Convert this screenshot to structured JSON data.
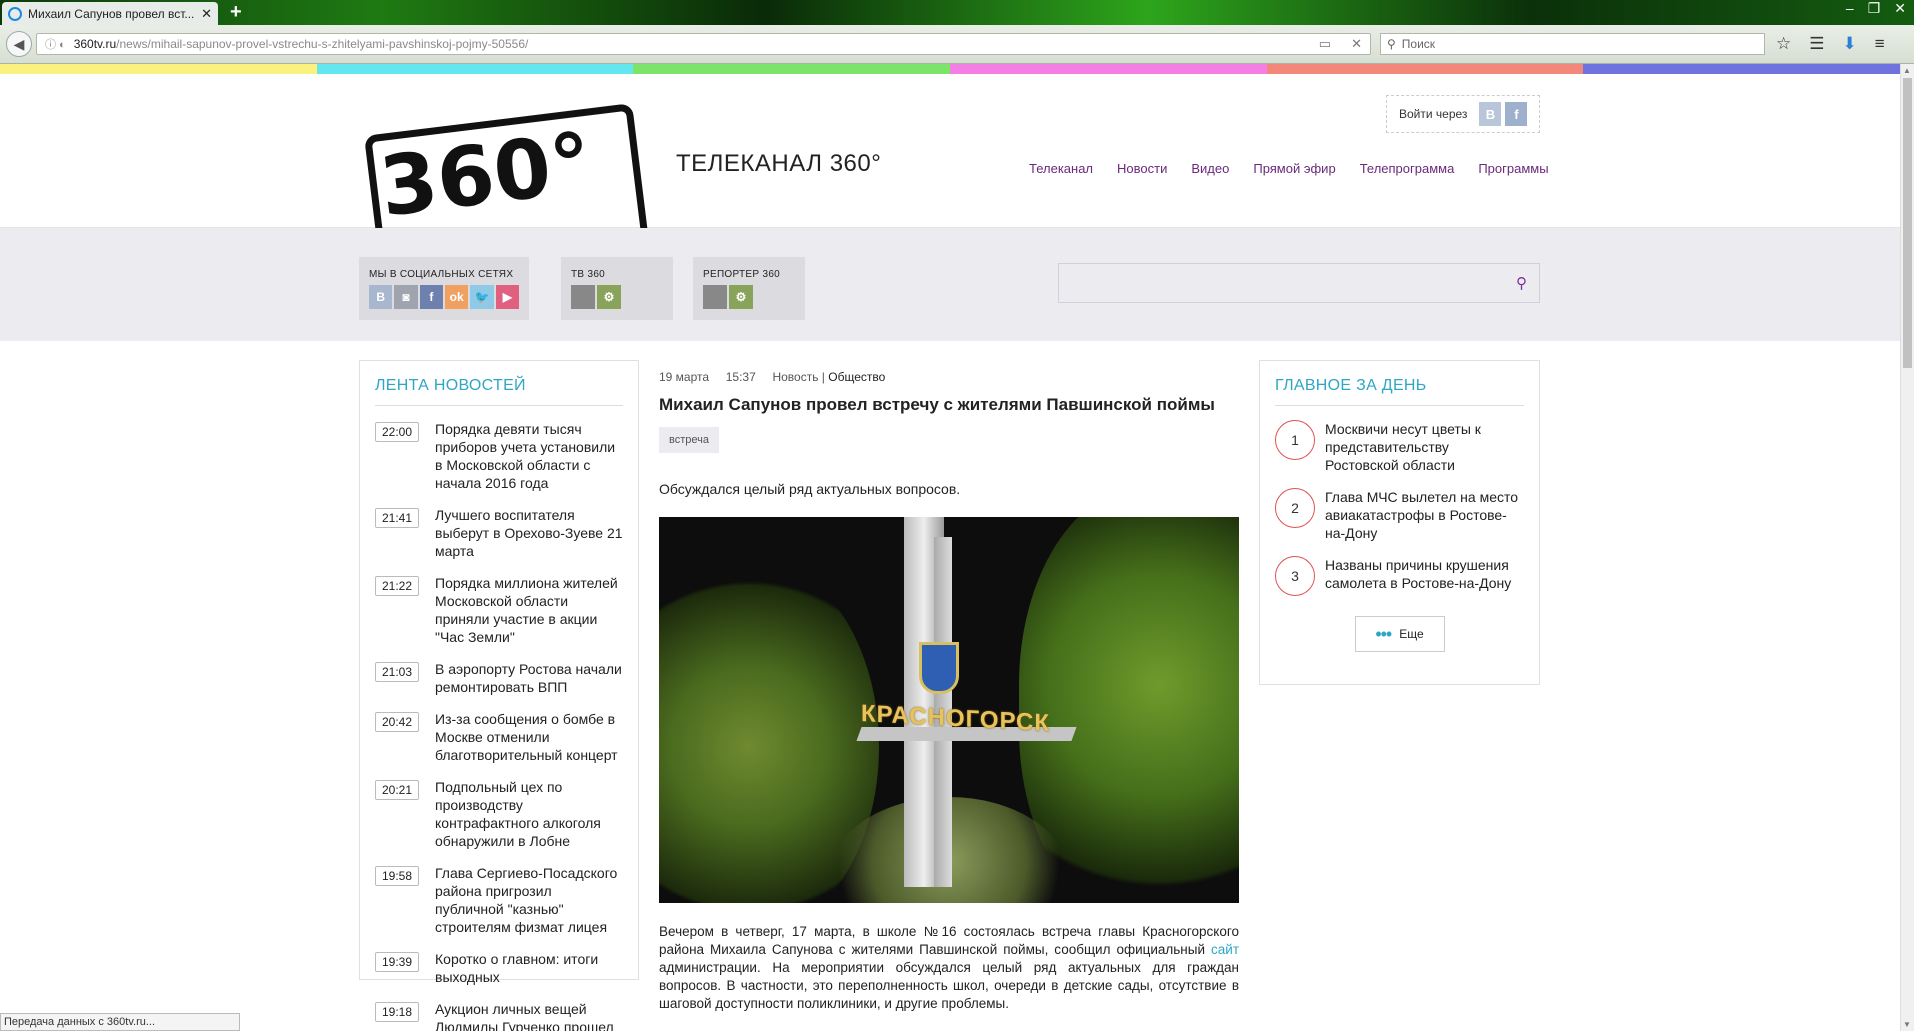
{
  "browser": {
    "tab_title": "Михаил Сапунов провел вст...",
    "new_tab": "+",
    "url_host": "360tv.ru",
    "url_path": "/news/mihail-sapunov-provel-vstrechu-s-zhitelyami-pavshinskoj-pojmy-50556/",
    "search_placeholder": "Поиск",
    "status_text": "Передача данных с 360tv.ru..."
  },
  "colors": {
    "stripe": [
      "#fbf17e",
      "#64e6ef",
      "#7de46a",
      "#f37ee4",
      "#f3877a",
      "#6e73e0"
    ],
    "accent": "#2fa7c4",
    "nav_link": "#6a2a7a"
  },
  "header": {
    "logo_text": "360°",
    "channel_title": "ТЕЛЕКАНАЛ 360°",
    "login_label": "Войти через",
    "login_vk": "B",
    "login_fb": "f",
    "nav": [
      "Телеканал",
      "Новости",
      "Видео",
      "Прямой эфир",
      "Телепрограмма",
      "Программы"
    ]
  },
  "subband": {
    "social_label": "МЫ В СОЦИАЛЬНЫХ СЕТЯХ",
    "social_icons": [
      "vk-icon",
      "instagram-icon",
      "facebook-icon",
      "odnoklassniki-icon",
      "twitter-icon",
      "youtube-icon"
    ],
    "tv_label": "ТВ 360",
    "reporter_label": "РЕПОРТЕР 360"
  },
  "news_feed": {
    "title": "ЛЕНТА НОВОСТЕЙ",
    "items": [
      {
        "time": "22:00",
        "text": "Порядка девяти тысяч приборов учета установили в Московской области с начала 2016 года"
      },
      {
        "time": "21:41",
        "text": "Лучшего воспитателя выберут в Орехово-Зуеве 21 марта"
      },
      {
        "time": "21:22",
        "text": "Порядка миллиона жителей Московской области приняли участие в акции \"Час Земли\""
      },
      {
        "time": "21:03",
        "text": "В аэропорту Ростова начали ремонтировать ВПП"
      },
      {
        "time": "20:42",
        "text": "Из-за сообщения о бомбе в Москве отменили благотворительный концерт"
      },
      {
        "time": "20:21",
        "text": "Подпольный цех по производству контрафактного алкоголя обнаружили в Лобне"
      },
      {
        "time": "19:58",
        "text": "Глава Сергиево-Посадского района пригрозил публичной \"казнью\" строителям физмат лицея"
      },
      {
        "time": "19:39",
        "text": "Коротко о главном: итоги выходных"
      },
      {
        "time": "19:18",
        "text": "Аукцион личных вещей Людмилы Гурченко прошел"
      }
    ]
  },
  "article": {
    "date": "19 марта",
    "time": "15:37",
    "section": "Новость",
    "separator": "|",
    "category": "Общество",
    "title": "Михаил Сапунов провел встречу с жителями Павшинской поймы",
    "tag": "встреча",
    "lead": "Обсуждался целый ряд актуальных вопросов.",
    "photo_sign": "КРАСНОГОРСК",
    "body_before_link": "Вечером в четверг, 17 марта, в школе №16 состоялась встреча главы Красногорского района Михаила Сапунова с жителями Павшинской поймы, сообщил официальный",
    "body_link": "сайт",
    "body_after_link": "администрации. На мероприятии обсуждался целый ряд актуальных для граждан вопросов. В частности, это переполненность школ, очереди в детские сады, отсутствие в шаговой доступности поликлиники, и другие проблемы."
  },
  "top_day": {
    "title": "ГЛАВНОЕ ЗА ДЕНЬ",
    "items": [
      {
        "num": "1",
        "text": "Москвичи несут цветы к представительству Ростовской области"
      },
      {
        "num": "2",
        "text": "Глава МЧС вылетел на место авиакатастрофы в Ростове-на-Дону"
      },
      {
        "num": "3",
        "text": "Названы причины крушения самолета в Ростове-на-Дону"
      }
    ],
    "more_label": "Еще"
  }
}
